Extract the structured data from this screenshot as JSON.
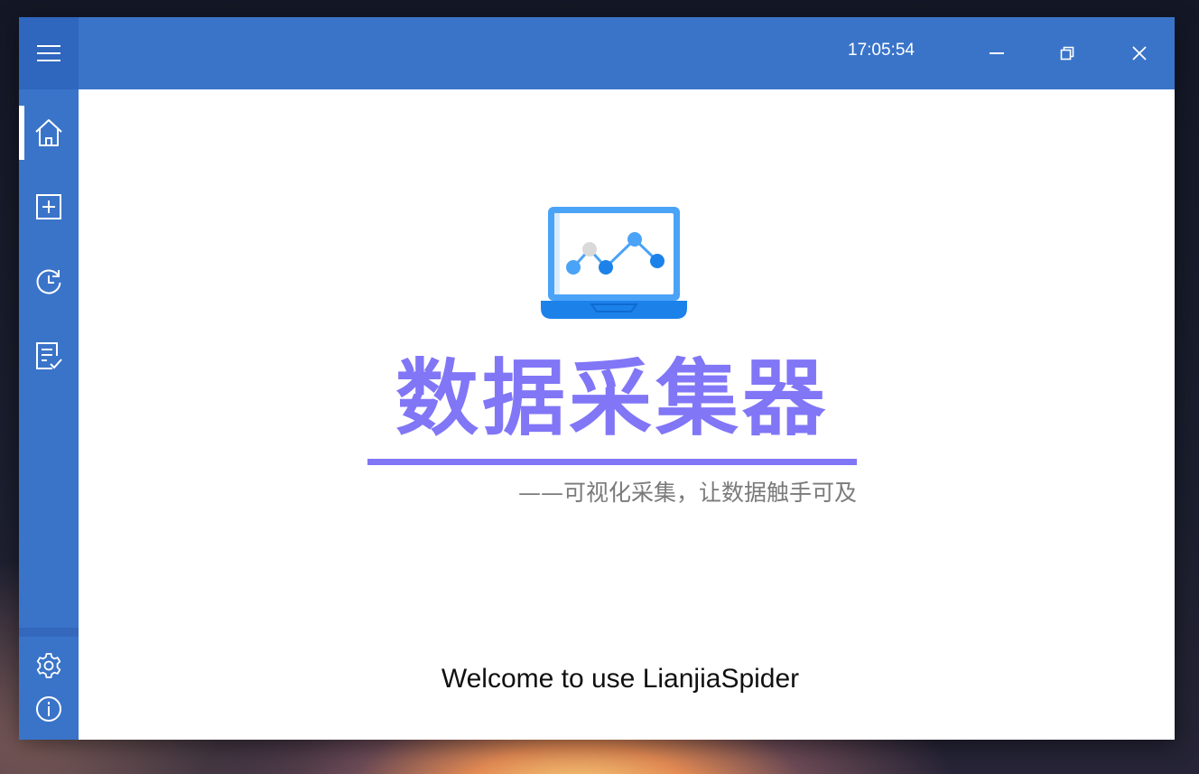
{
  "titlebar": {
    "clock": "17:05:54",
    "menu_icon": "hamburger-menu-icon",
    "buttons": [
      "minimize-icon",
      "restore-icon",
      "close-icon"
    ]
  },
  "sidebar": {
    "items": [
      {
        "icon": "home-icon",
        "active": true
      },
      {
        "icon": "add-box-icon",
        "active": false
      },
      {
        "icon": "history-clock-icon",
        "active": false
      },
      {
        "icon": "checklist-document-icon",
        "active": false
      }
    ],
    "bottom": [
      {
        "icon": "gear-icon"
      },
      {
        "icon": "info-icon"
      }
    ]
  },
  "main": {
    "logo_icon": "laptop-line-chart-icon",
    "title": "数据采集器",
    "subtitle": "——可视化采集，让数据触手可及",
    "welcome": "Welcome to use LianjiaSpider"
  },
  "colors": {
    "primary": "#3a74c9",
    "title": "#8176f6",
    "subtitle": "#7a7a7a",
    "background": "#ffffff"
  }
}
